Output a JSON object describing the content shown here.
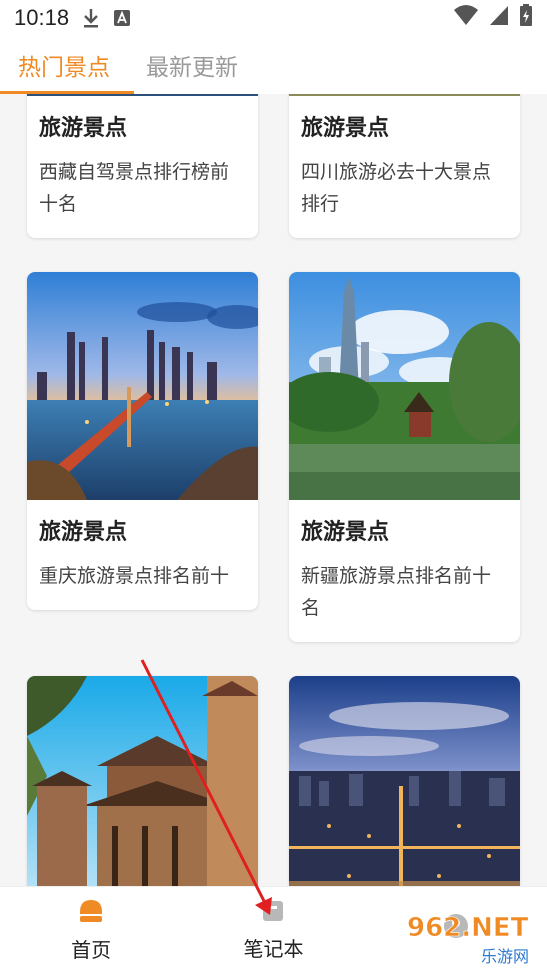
{
  "status_bar": {
    "time": "10:18",
    "icons": [
      "download-icon",
      "notification-a-icon",
      "wifi-icon",
      "signal-icon",
      "battery-icon"
    ]
  },
  "tabs": [
    {
      "label": "热门景点",
      "active": true
    },
    {
      "label": "最新更新",
      "active": false
    }
  ],
  "colors": {
    "accent": "#f08a24",
    "inactive_tab": "#9a9a9a",
    "arrow": "#e02020"
  },
  "cards": [
    {
      "category": "旅游景点",
      "desc": "西藏自驾景点排行榜前十名"
    },
    {
      "category": "旅游景点",
      "desc": "四川旅游必去十大景点排行"
    },
    {
      "category": "旅游景点",
      "desc": "重庆旅游景点排名前十"
    },
    {
      "category": "旅游景点",
      "desc": "新疆旅游景点排名前十名"
    },
    {
      "category": "",
      "desc": ""
    },
    {
      "category": "",
      "desc": ""
    }
  ],
  "bottom_nav": [
    {
      "label": "首页",
      "icon": "home-icon",
      "active": true
    },
    {
      "label": "笔记本",
      "icon": "notebook-icon",
      "active": false
    },
    {
      "label": "",
      "icon": "user-icon",
      "active": false
    }
  ],
  "watermark": {
    "logo_text": "962.NET",
    "sub_text": "乐游网"
  }
}
